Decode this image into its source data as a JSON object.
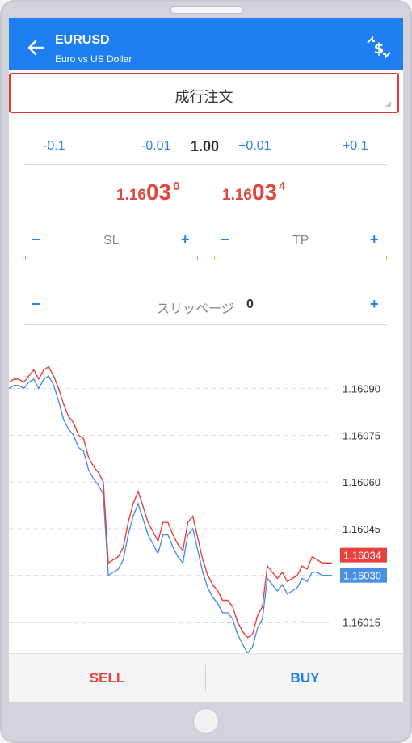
{
  "header": {
    "title": "EURUSD",
    "subtitle": "Euro vs US Dollar",
    "back_icon": "arrow-left-icon",
    "exchange_icon": "currency-exchange-icon",
    "background": "#1e7ff3"
  },
  "order_type": {
    "label": "成行注文"
  },
  "volume": {
    "minus_big": "-0.1",
    "minus_small": "-0.01",
    "value": "1.00",
    "plus_small": "+0.01",
    "plus_big": "+0.1"
  },
  "prices": {
    "sell": {
      "prefix": "1.16",
      "big": "03",
      "sup": "0"
    },
    "buy": {
      "prefix": "1.16",
      "big": "03",
      "sup": "4"
    },
    "color": "#e0493d"
  },
  "sl": {
    "minus": "−",
    "label": "SL",
    "plus": "+"
  },
  "tp": {
    "minus": "−",
    "label": "TP",
    "plus": "+"
  },
  "slippage": {
    "minus": "−",
    "label": "スリッページ",
    "value": "0",
    "plus": "+"
  },
  "chart_data": {
    "type": "line",
    "y_ticks": [
      "1.16090",
      "1.16075",
      "1.16060",
      "1.16045",
      "1.16030",
      "1.16015"
    ],
    "ylim": [
      1.16005,
      1.161
    ],
    "current_ask_label": "1.16034",
    "current_bid_label": "1.16030",
    "ask_color": "#e8403c",
    "bid_color": "#4a90e2",
    "series": [
      {
        "values": [
          1.16092,
          1.16093,
          1.16093,
          1.16092,
          1.16094,
          1.16096,
          1.16093,
          1.16096,
          1.16097,
          1.16094,
          1.1609,
          1.16085,
          1.16081,
          1.16079,
          1.16075,
          1.16074,
          1.16068,
          1.16065,
          1.16063,
          1.1606,
          1.16034,
          1.16035,
          1.16036,
          1.16039,
          1.16047,
          1.16053,
          1.16057,
          1.16052,
          1.16047,
          1.16044,
          1.16041,
          1.16047,
          1.16047,
          1.16043,
          1.1604,
          1.16038,
          1.16047,
          1.16049,
          1.16042,
          1.16035,
          1.1603,
          1.16027,
          1.16025,
          1.16022,
          1.16022,
          1.1602,
          1.16015,
          1.16012,
          1.1601,
          1.16011,
          1.16017,
          1.1602,
          1.16033,
          1.16031,
          1.16029,
          1.16031,
          1.16028,
          1.16029,
          1.1603,
          1.16033,
          1.16032,
          1.16036,
          1.16035,
          1.16034,
          1.16034,
          1.16034
        ]
      },
      {
        "values": [
          1.1609,
          1.16091,
          1.16091,
          1.1609,
          1.16092,
          1.16093,
          1.1609,
          1.16093,
          1.16094,
          1.16091,
          1.16086,
          1.1608,
          1.16077,
          1.16075,
          1.16071,
          1.1607,
          1.16064,
          1.16061,
          1.16059,
          1.16056,
          1.1603,
          1.16031,
          1.16032,
          1.16035,
          1.16043,
          1.16049,
          1.16053,
          1.16048,
          1.16043,
          1.1604,
          1.16037,
          1.16043,
          1.16043,
          1.16039,
          1.16036,
          1.16034,
          1.16043,
          1.16045,
          1.16038,
          1.16031,
          1.16026,
          1.16023,
          1.16021,
          1.16018,
          1.16018,
          1.16016,
          1.16011,
          1.16008,
          1.16005,
          1.16007,
          1.16013,
          1.16016,
          1.16029,
          1.16027,
          1.16025,
          1.16027,
          1.16024,
          1.16025,
          1.16026,
          1.16029,
          1.16028,
          1.16031,
          1.16031,
          1.1603,
          1.1603,
          1.1603
        ]
      }
    ]
  },
  "actions": {
    "sell": "SELL",
    "buy": "BUY"
  }
}
